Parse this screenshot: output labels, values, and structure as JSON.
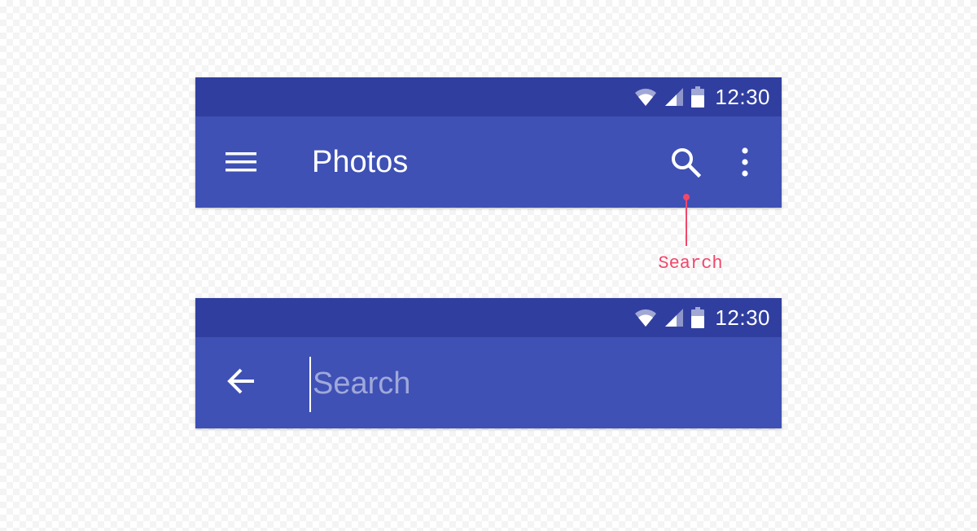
{
  "toolbar_default": {
    "status_bar": {
      "time": "12:30",
      "icons": [
        "wifi-icon",
        "cellular-signal-icon",
        "battery-icon"
      ]
    },
    "app_bar": {
      "nav_icon": "menu-icon",
      "title": "Photos",
      "actions": [
        "search-icon",
        "more-vert-icon"
      ]
    }
  },
  "annotation": {
    "label": "Search"
  },
  "toolbar_search": {
    "status_bar": {
      "time": "12:30",
      "icons": [
        "wifi-icon",
        "cellular-signal-icon",
        "battery-icon"
      ]
    },
    "app_bar": {
      "nav_icon": "arrow-back-icon",
      "search_placeholder": "Search",
      "search_value": ""
    }
  },
  "colors": {
    "status_bar": "#303f9f",
    "app_bar": "#3f51b5",
    "placeholder": "#9fa8da",
    "annotation": "#f2476b",
    "icon": "#ffffff"
  }
}
